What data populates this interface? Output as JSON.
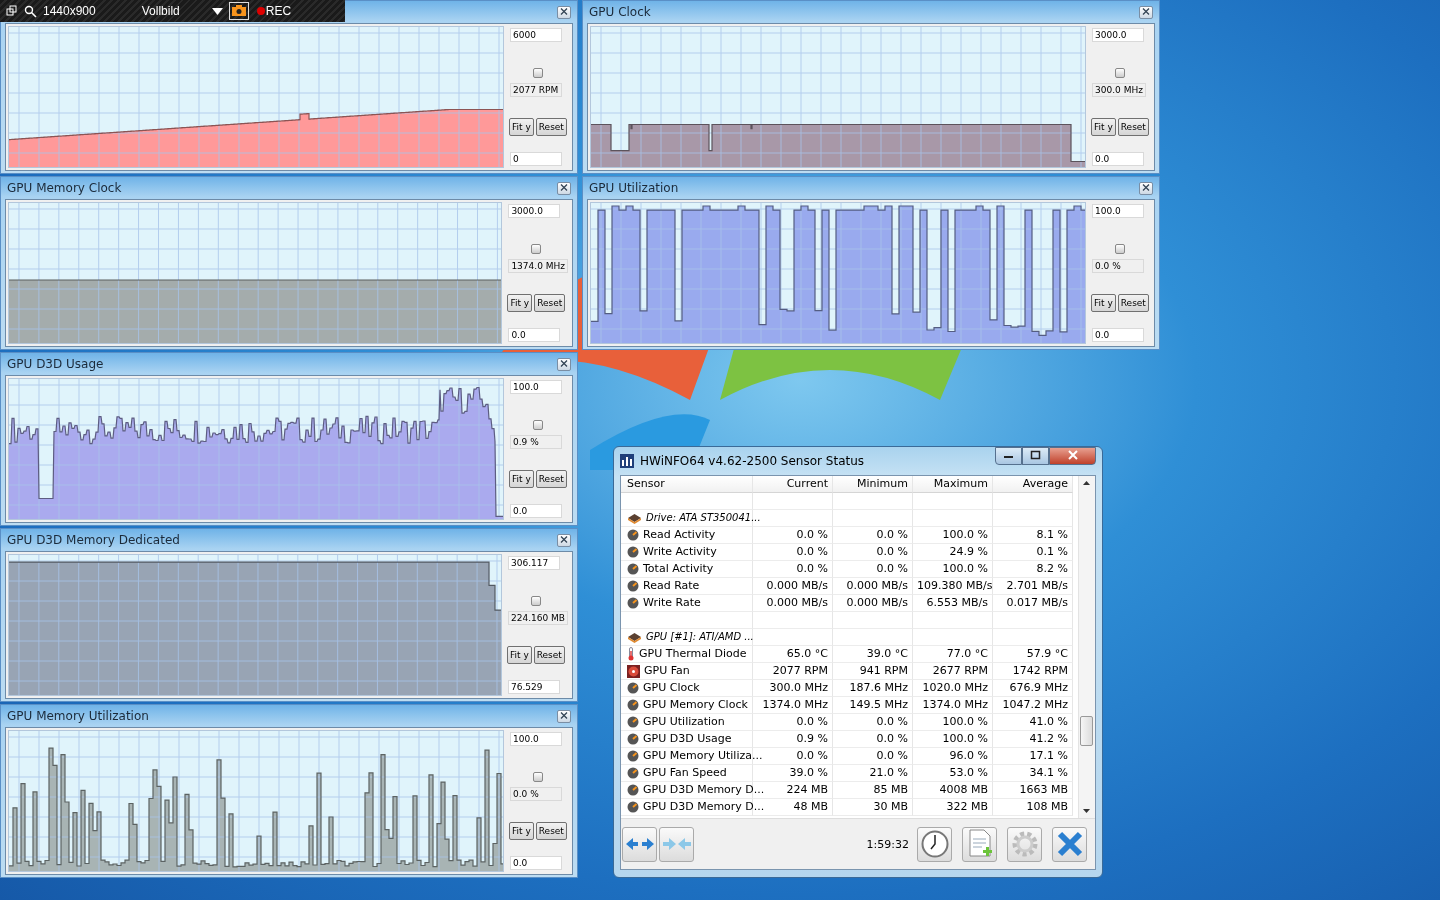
{
  "recorder_bar": {
    "size": "1440x900",
    "mode": "Vollbild",
    "rec": "REC"
  },
  "left_graph_windows": [
    {
      "kind": "fan",
      "color": "#ff9999",
      "max": "6000",
      "current": "2077 RPM",
      "min": "0",
      "checked": false,
      "fit": "Fit y",
      "reset": "Reset"
    },
    {
      "title": "GPU Memory Clock",
      "kind": "flat",
      "color": "#a4acac",
      "max": "3000.0",
      "current": "1374.0 MHz",
      "min": "0.0",
      "checked": false,
      "fit": "Fit y",
      "reset": "Reset"
    },
    {
      "title": "GPU D3D Usage",
      "kind": "noisy",
      "color": "#aaaaee",
      "max": "100.0",
      "current": "0.9 %",
      "min": "0.0",
      "checked": false,
      "fit": "Fit y",
      "reset": "Reset"
    },
    {
      "title": "GPU D3D Memory Dedicated",
      "kind": "high",
      "color": "#98a4b4",
      "max": "306.117",
      "current": "224.160 MB",
      "min": "76.529",
      "checked": false,
      "fit": "Fit y",
      "reset": "Reset"
    },
    {
      "title": "GPU Memory Utilization",
      "kind": "spikes",
      "color": "#a8b4b4",
      "max": "100.0",
      "current": "0.0 %",
      "min": "0.0",
      "checked": false,
      "fit": "Fit y",
      "reset": "Reset"
    }
  ],
  "right_graph_windows": [
    {
      "title": "GPU Clock",
      "kind": "clock",
      "color": "#a898a8",
      "max": "3000.0",
      "current": "300.0 MHz",
      "min": "0.0",
      "checked": false,
      "fit": "Fit y",
      "reset": "Reset"
    },
    {
      "title": "GPU Utilization",
      "kind": "square",
      "color": "#99aaee",
      "max": "100.0",
      "current": "0.0 %",
      "min": "0.0",
      "checked": false,
      "fit": "Fit y",
      "reset": "Reset"
    }
  ],
  "sensor_window": {
    "title": "HWiNFO64 v4.62-2500 Sensor Status",
    "columns": [
      "Sensor",
      "Current",
      "Minimum",
      "Maximum",
      "Average"
    ],
    "rows": [
      {
        "kind": "blank"
      },
      {
        "kind": "group",
        "sensor": "Drive: ATA ST350041..."
      },
      {
        "kind": "gauge",
        "sensor": "Read Activity",
        "current": "0.0 %",
        "minimum": "0.0 %",
        "maximum": "100.0 %",
        "average": "8.1 %"
      },
      {
        "kind": "gauge",
        "sensor": "Write Activity",
        "current": "0.0 %",
        "minimum": "0.0 %",
        "maximum": "24.9 %",
        "average": "0.1 %"
      },
      {
        "kind": "gauge",
        "sensor": "Total Activity",
        "current": "0.0 %",
        "minimum": "0.0 %",
        "maximum": "100.0 %",
        "average": "8.2 %"
      },
      {
        "kind": "gauge",
        "sensor": "Read Rate",
        "current": "0.000 MB/s",
        "minimum": "0.000 MB/s",
        "maximum": "109.380 MB/s",
        "average": "2.701 MB/s"
      },
      {
        "kind": "gauge",
        "sensor": "Write Rate",
        "current": "0.000 MB/s",
        "minimum": "0.000 MB/s",
        "maximum": "6.553 MB/s",
        "average": "0.017 MB/s"
      },
      {
        "kind": "blank"
      },
      {
        "kind": "group",
        "sensor": "GPU [#1]: ATI/AMD ..."
      },
      {
        "kind": "thermo",
        "sensor": "GPU Thermal Diode",
        "current": "65.0 °C",
        "minimum": "39.0 °C",
        "maximum": "77.0 °C",
        "average": "57.9 °C"
      },
      {
        "kind": "fan",
        "sensor": "GPU Fan",
        "current": "2077 RPM",
        "minimum": "941 RPM",
        "maximum": "2677 RPM",
        "average": "1742 RPM"
      },
      {
        "kind": "gauge",
        "sensor": "GPU Clock",
        "current": "300.0 MHz",
        "minimum": "187.6 MHz",
        "maximum": "1020.0 MHz",
        "average": "676.9 MHz"
      },
      {
        "kind": "gauge",
        "sensor": "GPU Memory Clock",
        "current": "1374.0 MHz",
        "minimum": "149.5 MHz",
        "maximum": "1374.0 MHz",
        "average": "1047.2 MHz"
      },
      {
        "kind": "gauge",
        "sensor": "GPU Utilization",
        "current": "0.0 %",
        "minimum": "0.0 %",
        "maximum": "100.0 %",
        "average": "41.0 %"
      },
      {
        "kind": "gauge",
        "sensor": "GPU D3D Usage",
        "current": "0.9 %",
        "minimum": "0.0 %",
        "maximum": "100.0 %",
        "average": "41.2 %"
      },
      {
        "kind": "gauge",
        "sensor": "GPU Memory Utiliza...",
        "current": "0.0 %",
        "minimum": "0.0 %",
        "maximum": "96.0 %",
        "average": "17.1 %"
      },
      {
        "kind": "gauge",
        "sensor": "GPU Fan Speed",
        "current": "39.0 %",
        "minimum": "21.0 %",
        "maximum": "53.0 %",
        "average": "34.1 %"
      },
      {
        "kind": "gauge",
        "sensor": "GPU D3D Memory D...",
        "current": "224 MB",
        "minimum": "85 MB",
        "maximum": "4008 MB",
        "average": "1663 MB"
      },
      {
        "kind": "gauge",
        "sensor": "GPU D3D Memory D...",
        "current": "48 MB",
        "minimum": "30 MB",
        "maximum": "322 MB",
        "average": "108 MB"
      }
    ],
    "elapsed": "1:59:32"
  }
}
